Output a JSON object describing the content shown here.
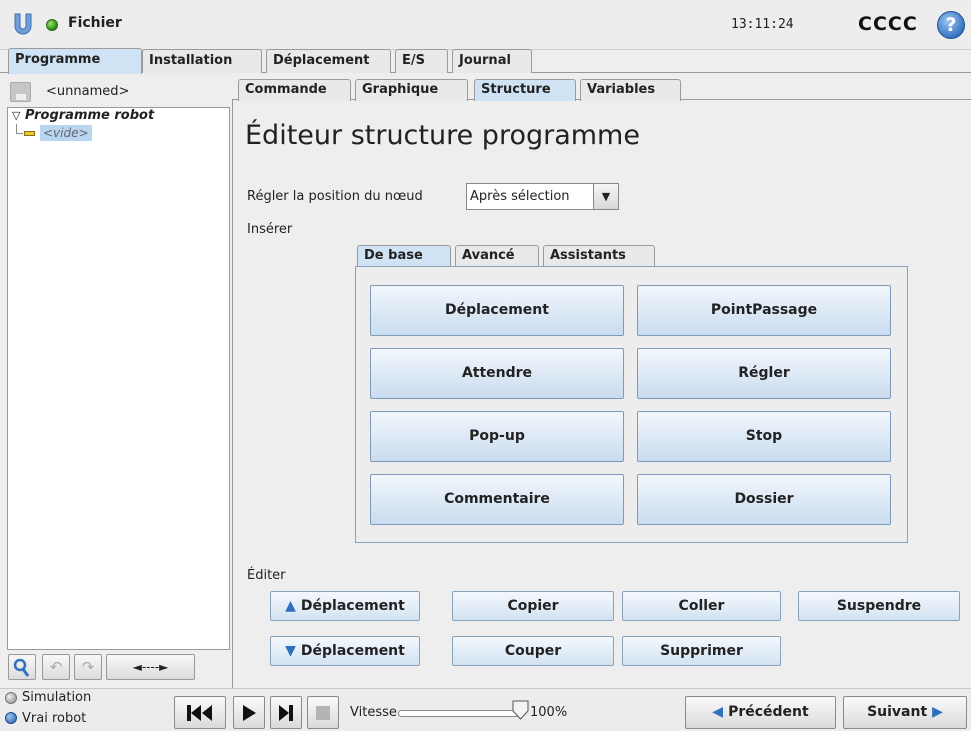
{
  "header": {
    "menu_label": "Fichier",
    "clock": "13:11:24",
    "robot_name": "CCCC",
    "help_icon": "?"
  },
  "main_tabs": [
    {
      "label": "Programme",
      "active": true
    },
    {
      "label": "Installation",
      "active": false
    },
    {
      "label": "Déplacement",
      "active": false
    },
    {
      "label": "E/S",
      "active": false
    },
    {
      "label": "Journal",
      "active": false
    }
  ],
  "program": {
    "name": "<unnamed>",
    "tree_root": "Programme robot",
    "tree_child": "<vide>"
  },
  "tree_toolbar": {
    "expand_arrows": "◄----►"
  },
  "sub_tabs": [
    {
      "label": "Commande",
      "active": false
    },
    {
      "label": "Graphique",
      "active": false
    },
    {
      "label": "Structure",
      "active": true
    },
    {
      "label": "Variables",
      "active": false
    }
  ],
  "editor": {
    "title": "Éditeur structure programme",
    "node_position_label": "Régler la position du nœud",
    "node_position_value": "Après sélection",
    "insert_label": "Insérer",
    "edit_label": "Éditer"
  },
  "insert_tabs": [
    {
      "label": "De base",
      "active": true
    },
    {
      "label": "Avancé",
      "active": false
    },
    {
      "label": "Assistants",
      "active": false
    }
  ],
  "insert_buttons": [
    "Déplacement",
    "PointPassage",
    "Attendre",
    "Régler",
    "Pop-up",
    "Stop",
    "Commentaire",
    "Dossier"
  ],
  "edit_buttons": {
    "move_up": "Déplacement",
    "copy": "Copier",
    "paste": "Coller",
    "suspend": "Suspendre",
    "move_down": "Déplacement",
    "cut": "Couper",
    "delete": "Supprimer"
  },
  "footer": {
    "simulation_label": "Simulation",
    "real_robot_label": "Vrai robot",
    "real_robot_selected": true,
    "speed_label": "Vitesse",
    "speed_value": "100%",
    "speed_fraction": 1.0,
    "prev_label": "Précédent",
    "next_label": "Suivant"
  },
  "colors": {
    "active_tab": "#cfe3f4",
    "button_gradient_bottom": "#c9dcef",
    "accent_blue": "#2f6fbf",
    "status_green": "#2c8a14"
  }
}
